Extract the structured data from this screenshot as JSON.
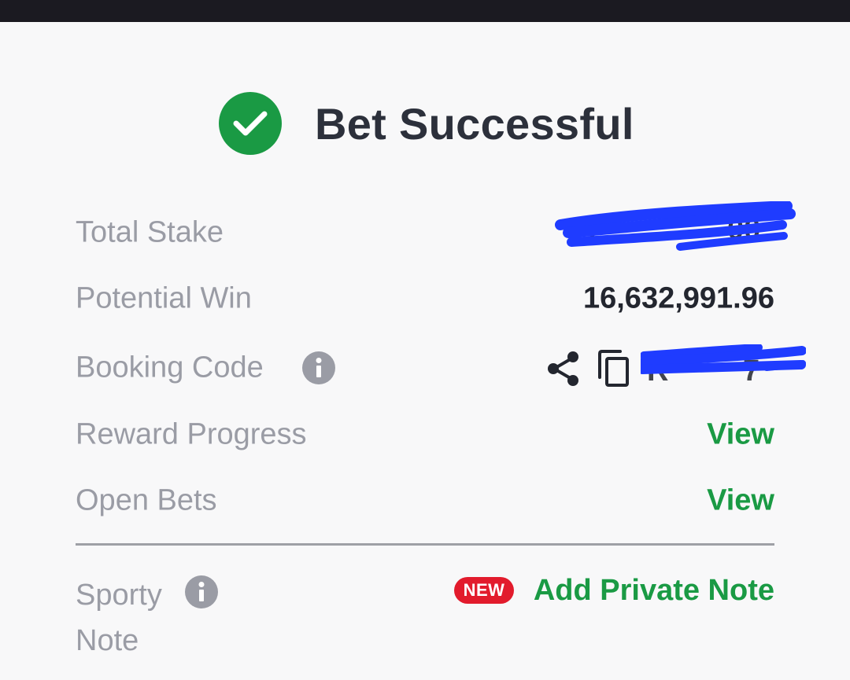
{
  "header": {
    "title": "Bet Successful",
    "status_icon": "check-circle-icon",
    "status_color": "#1a9a44"
  },
  "rows": {
    "total_stake": {
      "label": "Total Stake",
      "value_redacted": true
    },
    "potential_win": {
      "label": "Potential Win",
      "value": "16,632,991.96"
    },
    "booking_code": {
      "label": "Booking Code",
      "value_redacted": true,
      "icons": [
        "info-icon",
        "share-icon",
        "copy-icon"
      ]
    },
    "reward_progress": {
      "label": "Reward Progress",
      "action": "View"
    },
    "open_bets": {
      "label": "Open Bets",
      "action": "View"
    }
  },
  "note": {
    "label_line1": "Sporty",
    "label_line2": "Note",
    "badge": "NEW",
    "action": "Add Private Note"
  },
  "colors": {
    "accent_green": "#1a9a44",
    "badge_red": "#e21b2c",
    "redaction_blue": "#1f3cff",
    "label_gray": "#9a9ca5",
    "value_dark": "#23262f"
  }
}
